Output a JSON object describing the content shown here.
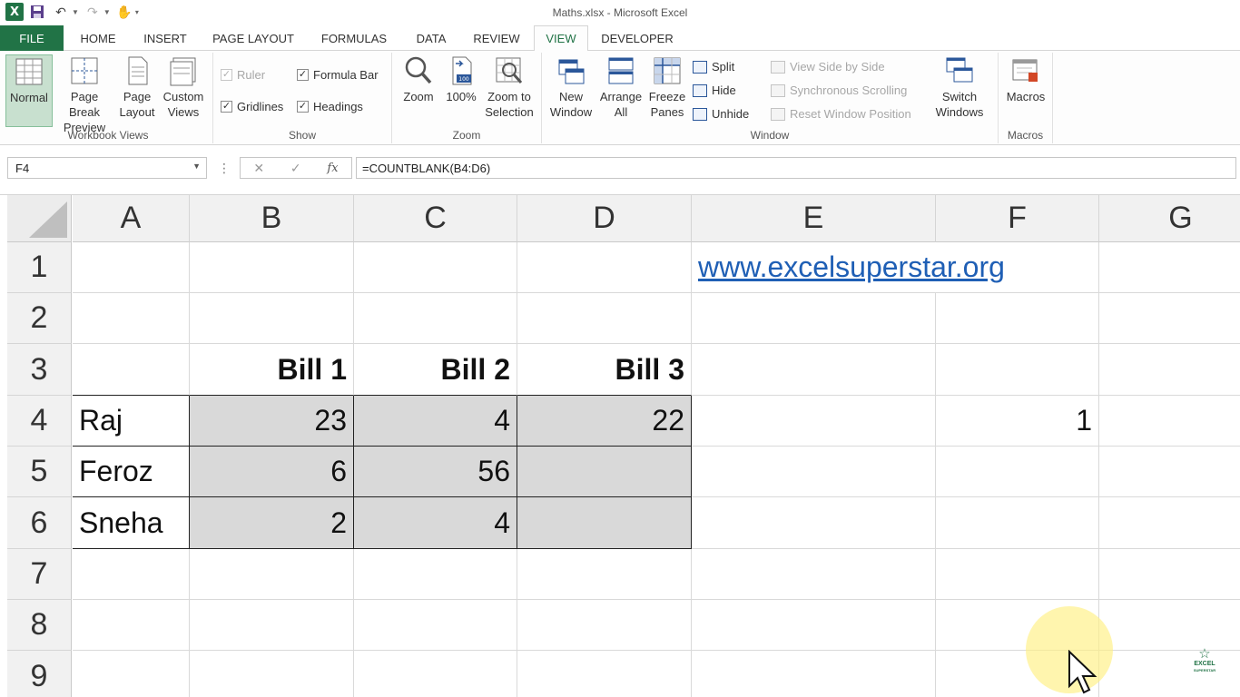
{
  "window": {
    "title": "Maths.xlsx - Microsoft Excel"
  },
  "tabs": [
    {
      "label": "FILE"
    },
    {
      "label": "HOME"
    },
    {
      "label": "INSERT"
    },
    {
      "label": "PAGE LAYOUT"
    },
    {
      "label": "FORMULAS"
    },
    {
      "label": "DATA"
    },
    {
      "label": "REVIEW"
    },
    {
      "label": "VIEW"
    },
    {
      "label": "DEVELOPER"
    }
  ],
  "active_tab": "VIEW",
  "ribbon": {
    "workbook_views": {
      "label": "Workbook Views",
      "normal": "Normal",
      "page_break_l1": "Page Break",
      "page_break_l2": "Preview",
      "page_layout_l1": "Page",
      "page_layout_l2": "Layout",
      "custom_views_l1": "Custom",
      "custom_views_l2": "Views"
    },
    "show": {
      "label": "Show",
      "ruler": "Ruler",
      "formula_bar": "Formula Bar",
      "gridlines": "Gridlines",
      "headings": "Headings"
    },
    "zoom": {
      "label": "Zoom",
      "zoom": "Zoom",
      "hundred": "100%",
      "zoom_sel_l1": "Zoom to",
      "zoom_sel_l2": "Selection"
    },
    "window": {
      "label": "Window",
      "new_l1": "New",
      "new_l2": "Window",
      "arrange_l1": "Arrange",
      "arrange_l2": "All",
      "freeze_l1": "Freeze",
      "freeze_l2": "Panes",
      "split": "Split",
      "hide": "Hide",
      "unhide": "Unhide",
      "side_by_side": "View Side by Side",
      "sync_scroll": "Synchronous Scrolling",
      "reset_pos": "Reset Window Position",
      "switch_l1": "Switch",
      "switch_l2": "Windows"
    },
    "macros": {
      "label": "Macros",
      "macros": "Macros"
    }
  },
  "formula_bar": {
    "name_box": "F4",
    "formula": "=COUNTBLANK(B4:D6)"
  },
  "columns": [
    "A",
    "B",
    "C",
    "D",
    "E",
    "F",
    "G"
  ],
  "rows": [
    "1",
    "2",
    "3",
    "4",
    "5",
    "6",
    "7",
    "8",
    "9"
  ],
  "cells": {
    "E1": "www.excelsuperstar.org",
    "B3": "Bill 1",
    "C3": "Bill 2",
    "D3": "Bill 3",
    "A4": "Raj",
    "B4": "23",
    "C4": "4",
    "D4": "22",
    "F4": "1",
    "A5": "Feroz",
    "B5": "6",
    "C5": "56",
    "A6": "Sneha",
    "B6": "2",
    "C6": "4"
  },
  "watermark": {
    "line1": "EXCEL",
    "line2": "SUPERSTAR"
  }
}
